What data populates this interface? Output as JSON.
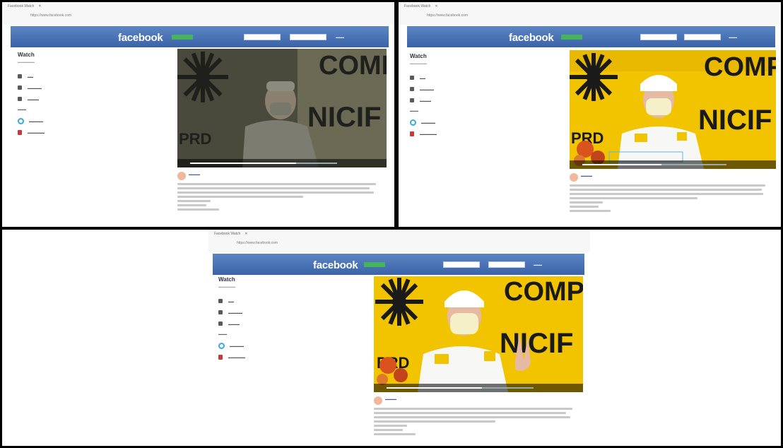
{
  "panels": [
    {
      "tab_title": "Facebook Watch",
      "url": "https://www.facebook.com",
      "logo": "facebook",
      "signup": "",
      "sidebar": {
        "heading": "Watch",
        "items": [
          {
            "icon": "home-icon"
          },
          {
            "icon": "live-icon"
          },
          {
            "icon": "saved-icon"
          }
        ],
        "following": [
          {
            "icon": "page-icon"
          },
          {
            "icon": "person-icon"
          }
        ]
      },
      "video": {
        "progress": 0.72,
        "dimmed": true
      },
      "post": {
        "likes": ""
      }
    },
    {
      "tab_title": "Facebook Watch",
      "url": "https://www.facebook.com",
      "logo": "facebook",
      "signup": "",
      "sidebar": {
        "heading": "Watch",
        "items": [
          {
            "icon": "home-icon"
          },
          {
            "icon": "live-icon"
          },
          {
            "icon": "saved-icon"
          }
        ],
        "following": [
          {
            "icon": "page-icon"
          },
          {
            "icon": "person-icon"
          }
        ]
      },
      "video": {
        "progress": 0.55,
        "dimmed": false
      },
      "post": {
        "likes": ""
      }
    },
    {
      "tab_title": "Facebook Watch",
      "url": "https://www.facebook.com",
      "logo": "facebook",
      "signup": "",
      "sidebar": {
        "heading": "Watch",
        "items": [
          {
            "icon": "home-icon"
          },
          {
            "icon": "live-icon"
          },
          {
            "icon": "saved-icon"
          }
        ],
        "following": [
          {
            "icon": "page-icon"
          },
          {
            "icon": "person-icon"
          }
        ]
      },
      "video": {
        "progress": 0.65,
        "dimmed": false
      },
      "post": {
        "likes": ""
      }
    }
  ],
  "video_sign_text": {
    "top": "COMPI",
    "side": "NICIF",
    "party": "PRD"
  },
  "colors": {
    "facebook_blue": "#3b63a8",
    "sign_yellow": "#f2c400",
    "sign_black": "#1a1a1a"
  }
}
